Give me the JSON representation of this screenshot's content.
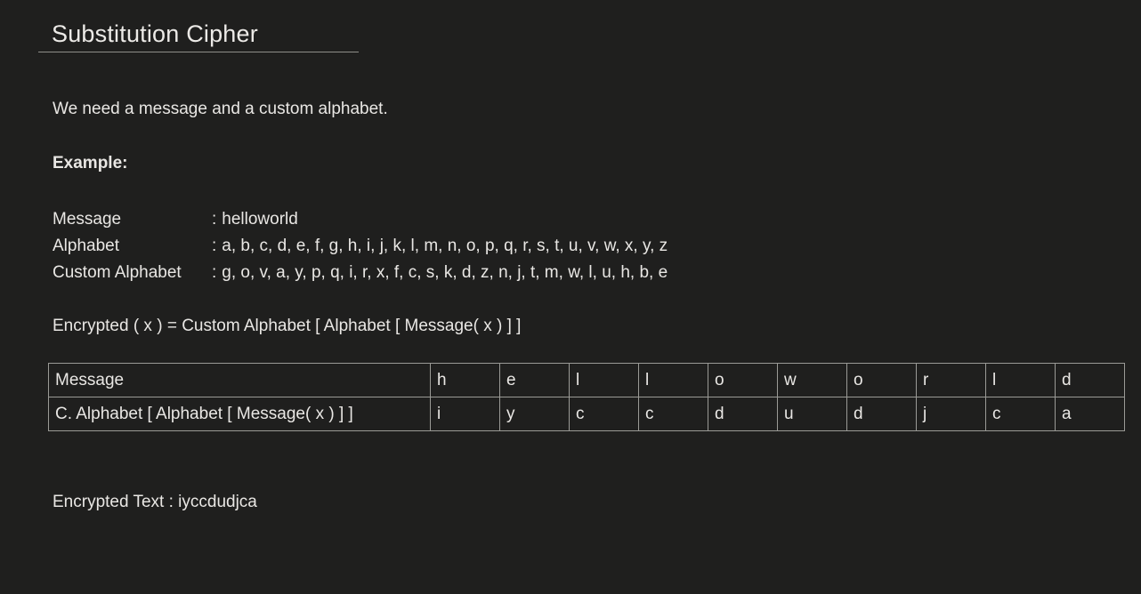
{
  "slide": {
    "title": "Substitution Cipher",
    "intro": "We need a message and a custom alphabet.",
    "example_heading": "Example:",
    "definitions": [
      {
        "label": "Message",
        "sep": ":",
        "value": "helloworld"
      },
      {
        "label": "Alphabet",
        "sep": ":",
        "value": "a, b, c, d, e, f, g, h, i, j, k, l, m, n, o, p, q, r, s, t, u, v, w, x, y, z"
      },
      {
        "label": "Custom Alphabet",
        "sep": ":",
        "value": "g, o, v, a, y, p, q, i, r, x, f, c, s, k, d, z, n, j, t, m, w, l, u, h, b, e"
      }
    ],
    "formula": "Encrypted ( x ) = Custom Alphabet [ Alphabet [ Message( x ) ] ]",
    "table": {
      "rows": [
        {
          "label": "Message",
          "cells": [
            "h",
            "e",
            "l",
            "l",
            "o",
            "w",
            "o",
            "r",
            "l",
            "d"
          ]
        },
        {
          "label": "C. Alphabet [ Alphabet [ Message( x ) ] ]",
          "cells": [
            "i",
            "y",
            "c",
            "c",
            "d",
            "u",
            "d",
            "j",
            "c",
            "a"
          ]
        }
      ]
    },
    "encrypted_text": "Encrypted Text : iyccdudjca",
    "colors": {
      "background": "#1f1f1e",
      "text": "#e9e7e4",
      "rule": "#8e8e8a",
      "table_border": "#9a9a96"
    }
  }
}
